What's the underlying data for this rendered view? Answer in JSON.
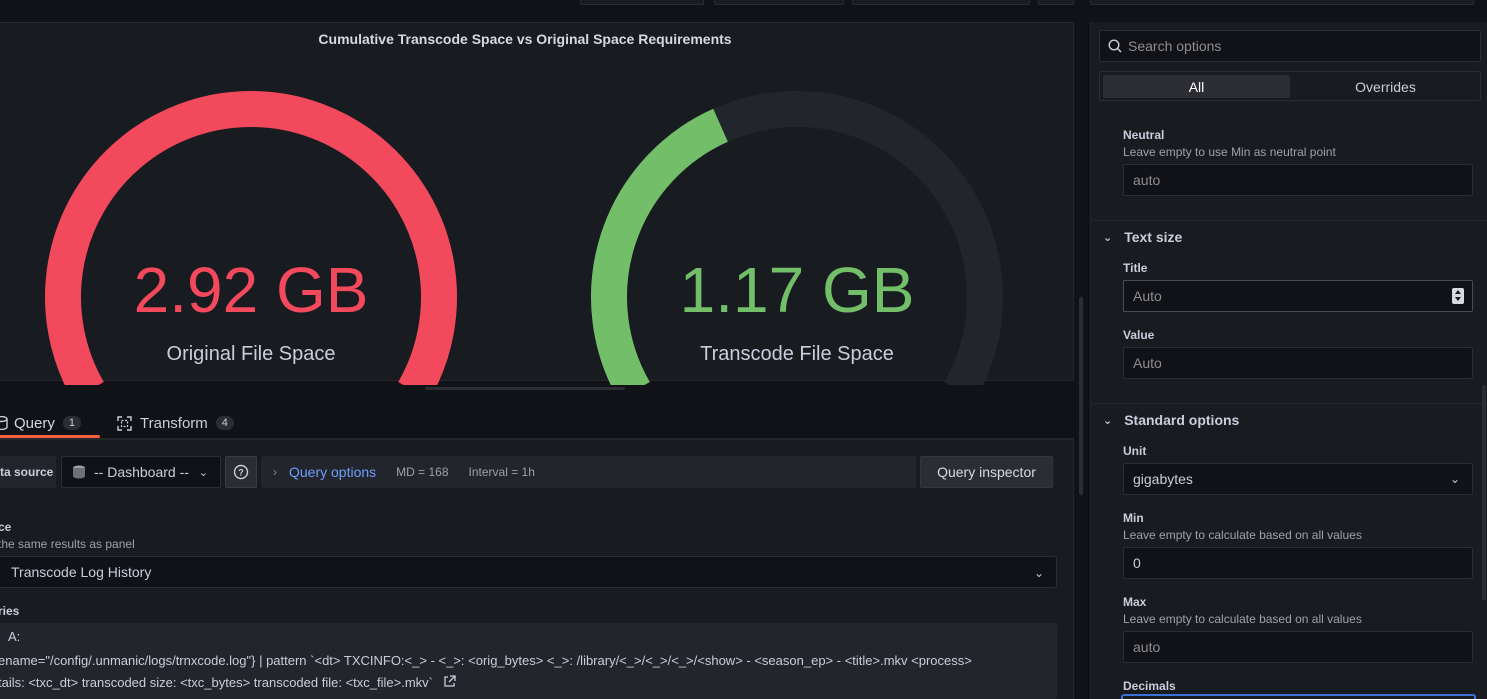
{
  "panel": {
    "title": "Cumulative Transcode Space vs Original Space Requirements",
    "gauges": [
      {
        "value": "2.92 GB",
        "label": "Original File Space",
        "color": "#f2495c",
        "fill_fraction": 1.0
      },
      {
        "value": "1.17 GB",
        "label": "Transcode File Space",
        "color": "#73bf69",
        "fill_fraction": 0.4
      }
    ],
    "track_color": "#22252b"
  },
  "tabs": [
    {
      "label": "Query",
      "count": "1",
      "active": true
    },
    {
      "label": "Transform",
      "count": "4",
      "active": false
    }
  ],
  "query_row": {
    "data_source_label": "ta source",
    "data_source_value": "-- Dashboard --",
    "query_options_label": "Query options",
    "md": "MD = 168",
    "interval": "Interval = 1h",
    "inspector_label": "Query inspector"
  },
  "source": {
    "label": "ce",
    "description": "the same results as panel",
    "value": "Transcode Log History"
  },
  "queries": {
    "label": "ries",
    "query_id": "A:",
    "line1": "ename=\"/config/.unmanic/logs/trnxcode.log\"} | pattern `<dt> TXCINFO:<_> - <_>: <orig_bytes> <_>: /library/<_>/<_>/<_>/<show> - <season_ep> - <title>.mkv <process>",
    "line2": "tails: <txc_dt> transcoded size: <txc_bytes> transcoded file: <txc_file>.mkv`"
  },
  "options": {
    "search_placeholder": "Search options",
    "seg_all": "All",
    "seg_overrides": "Overrides",
    "neutral_label": "Neutral",
    "neutral_desc": "Leave empty to use Min as neutral point",
    "neutral_placeholder": "auto",
    "text_size_section": "Text size",
    "title_label": "Title",
    "title_placeholder": "Auto",
    "value_label": "Value",
    "value_placeholder": "Auto",
    "standard_section": "Standard options",
    "unit_label": "Unit",
    "unit_value": "gigabytes",
    "min_label": "Min",
    "min_desc": "Leave empty to calculate based on all values",
    "min_value": "0",
    "max_label": "Max",
    "max_desc": "Leave empty to calculate based on all values",
    "max_placeholder": "auto",
    "decimals_label": "Decimals"
  }
}
